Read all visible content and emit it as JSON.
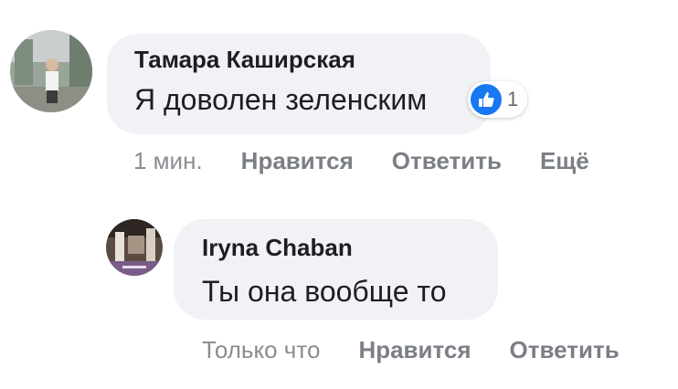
{
  "comments": [
    {
      "author": "Тамара Каширская",
      "text": "Я доволен зеленским",
      "reaction_count": "1",
      "time": "1 мин.",
      "like_label": "Нравится",
      "reply_label": "Ответить",
      "more_label": "Ещё"
    },
    {
      "author": "Iryna Chaban",
      "text": "Ты она вообще то",
      "time": "Только что",
      "like_label": "Нравится",
      "reply_label": "Ответить"
    }
  ],
  "colors": {
    "bubble": "#f0f2f5",
    "like_blue": "#1877f2",
    "action_text": "#7b7f85"
  },
  "icons": [
    "like-thumb-icon"
  ]
}
